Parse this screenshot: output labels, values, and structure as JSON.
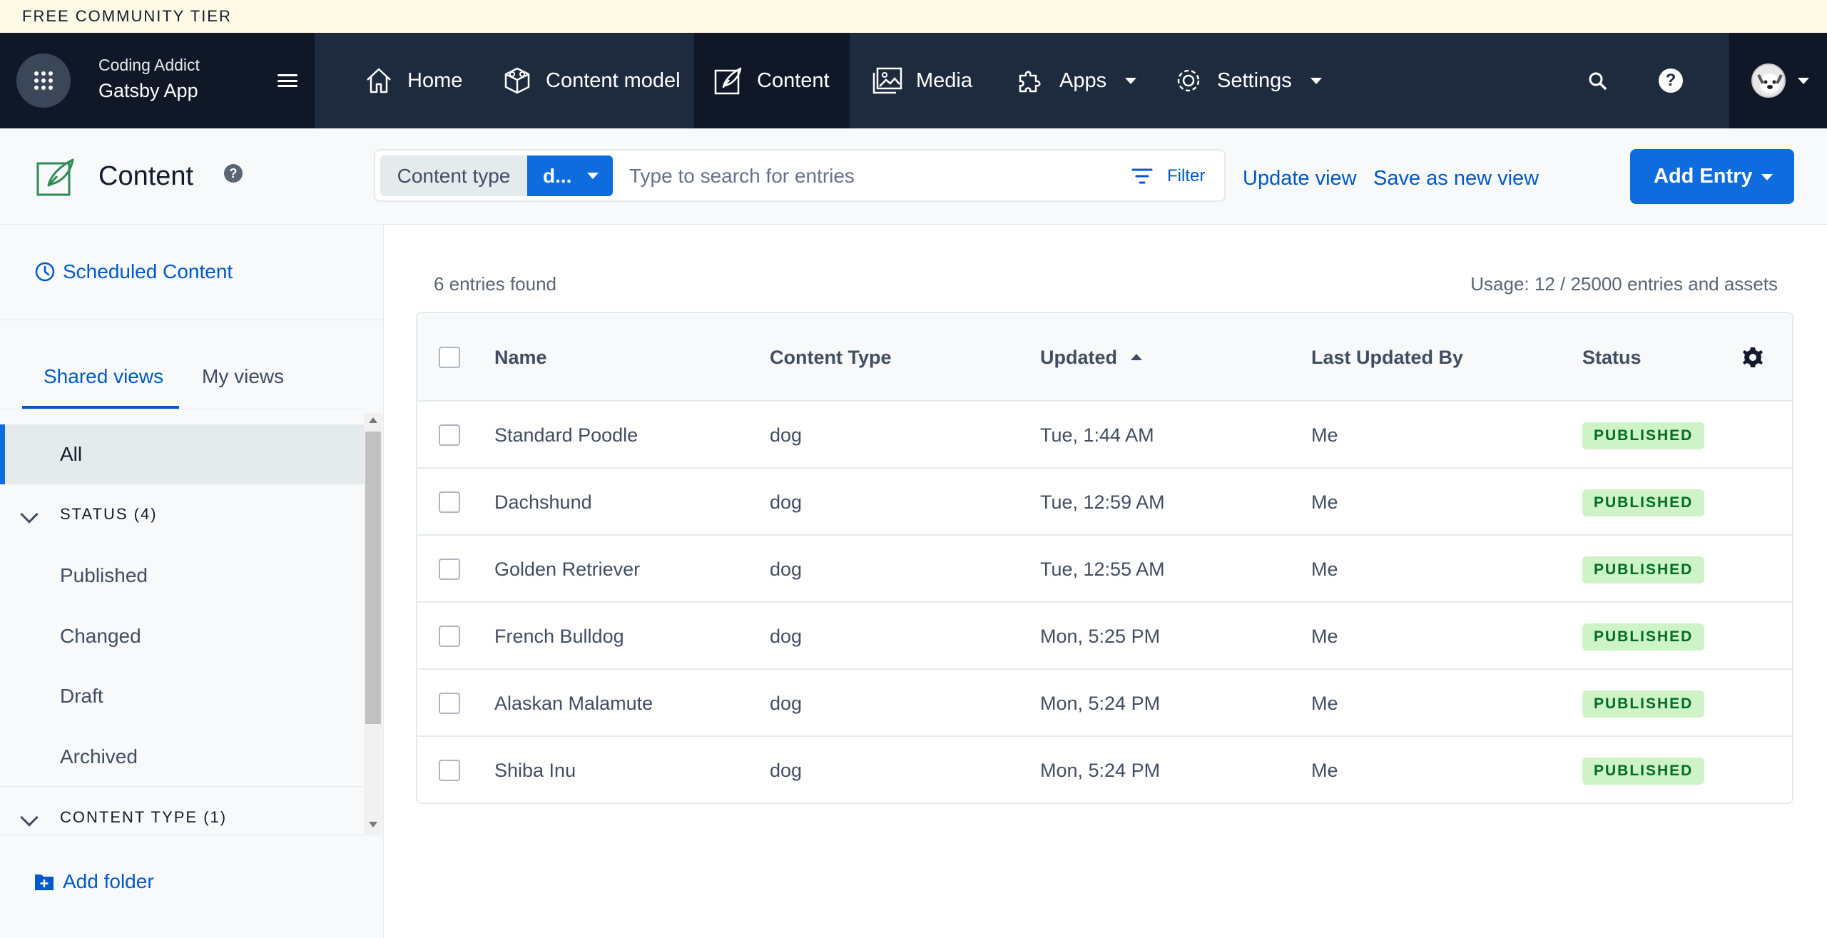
{
  "banner": {
    "text": "FREE COMMUNITY TIER"
  },
  "brand": {
    "org": "Coding Addict",
    "space": "Gatsby App"
  },
  "nav": {
    "items": [
      {
        "label": "Home",
        "icon": "home-icon"
      },
      {
        "label": "Content model",
        "icon": "content-model-icon"
      },
      {
        "label": "Content",
        "icon": "content-icon",
        "active": true
      },
      {
        "label": "Media",
        "icon": "media-icon"
      },
      {
        "label": "Apps",
        "icon": "apps-icon",
        "dropdown": true
      },
      {
        "label": "Settings",
        "icon": "settings-icon",
        "dropdown": true
      }
    ]
  },
  "workbench": {
    "title": "Content",
    "help": "?",
    "search": {
      "content_type_label": "Content type",
      "content_type_value": "d...",
      "placeholder": "Type to search for entries",
      "filter_label": "Filter"
    },
    "update_view": "Update view",
    "save_new_view": "Save as new view",
    "add_entry": "Add Entry"
  },
  "sidebar": {
    "scheduled": "Scheduled Content",
    "tabs": [
      "Shared views",
      "My views"
    ],
    "all": "All",
    "status_folder": "STATUS (4)",
    "status_items": [
      "Published",
      "Changed",
      "Draft",
      "Archived"
    ],
    "content_type_folder": "CONTENT TYPE (1)",
    "add_folder": "Add folder"
  },
  "main": {
    "entries_found": "6 entries found",
    "usage": "Usage: 12 / 25000 entries and assets",
    "columns": [
      "Name",
      "Content Type",
      "Updated",
      "Last Updated By",
      "Status"
    ],
    "rows": [
      {
        "name": "Standard Poodle",
        "type": "dog",
        "updated": "Tue, 1:44 AM",
        "by": "Me",
        "status": "PUBLISHED"
      },
      {
        "name": "Dachshund",
        "type": "dog",
        "updated": "Tue, 12:59 AM",
        "by": "Me",
        "status": "PUBLISHED"
      },
      {
        "name": "Golden Retriever",
        "type": "dog",
        "updated": "Tue, 12:55 AM",
        "by": "Me",
        "status": "PUBLISHED"
      },
      {
        "name": "French Bulldog",
        "type": "dog",
        "updated": "Mon, 5:25 PM",
        "by": "Me",
        "status": "PUBLISHED"
      },
      {
        "name": "Alaskan Malamute",
        "type": "dog",
        "updated": "Mon, 5:24 PM",
        "by": "Me",
        "status": "PUBLISHED"
      },
      {
        "name": "Shiba Inu",
        "type": "dog",
        "updated": "Mon, 5:24 PM",
        "by": "Me",
        "status": "PUBLISHED"
      }
    ]
  },
  "colors": {
    "nav_bg": "#1e2a3e",
    "nav_dark": "#101828",
    "primary": "#0f6cdf",
    "link": "#0059c8",
    "badge_bg": "#cdf3c6",
    "badge_text": "#006d23",
    "banner_bg": "#fff9e6"
  }
}
